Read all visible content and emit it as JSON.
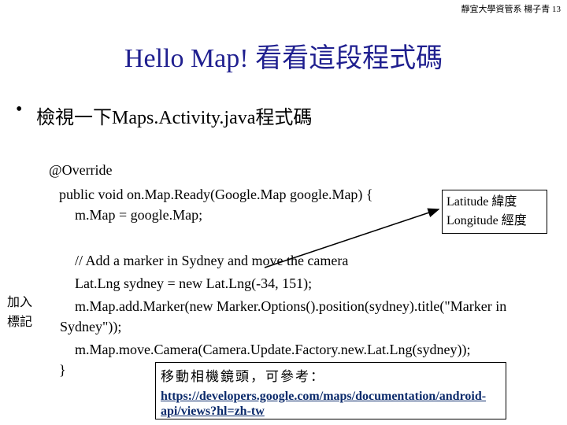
{
  "header": "靜宜大學資管系 楊子青 13",
  "title": "Hello Map! 看看這段程式碼",
  "bullet": {
    "symbol": "•",
    "text": "檢視一下Maps.Activity.java程式碼"
  },
  "code": {
    "line1": "@Override",
    "line2": "public void on.Map.Ready(Google.Map google.Map) {",
    "line3": "m.Map = google.Map;",
    "line4": "// Add a marker in Sydney and move the camera",
    "line5": "Lat.Lng sydney = new Lat.Lng(-34, 151);",
    "line6": "m.Map.add.Marker(new Marker.Options().position(sydney).title(\"Marker in",
    "line7": "Sydney\"));",
    "line8": "m.Map.move.Camera(Camera.Update.Factory.new.Lat.Lng(sydney));",
    "line9": "}"
  },
  "info_box": {
    "line1": "Latitude 緯度",
    "line2": "Longitude 經度"
  },
  "side_label": {
    "line1": "加入",
    "line2": "標記"
  },
  "tip_box": {
    "title": "移動相機鏡頭，可參考：",
    "link": "https://developers.google.com/maps/documentation/android-api/views?hl=zh-tw"
  }
}
